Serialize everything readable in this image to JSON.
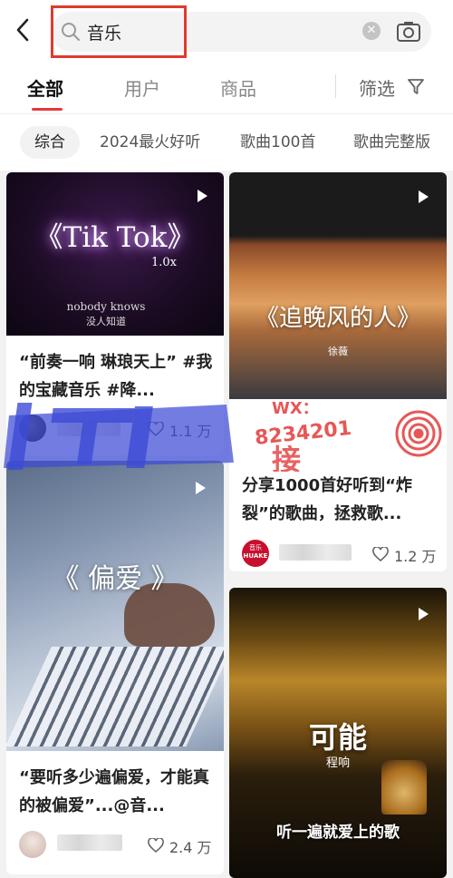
{
  "search": {
    "query": "音乐",
    "clear_glyph": "✕"
  },
  "tabs": [
    {
      "label": "全部"
    },
    {
      "label": "用户"
    },
    {
      "label": "商品"
    }
  ],
  "filter": {
    "label": "筛选"
  },
  "chips": [
    {
      "label": "综合"
    },
    {
      "label": "2024最火好听"
    },
    {
      "label": "歌曲100首"
    },
    {
      "label": "歌曲完整版"
    }
  ],
  "cards": [
    {
      "cover_title": "《Tik Tok》",
      "cover_speed": "1.0x",
      "cover_line1": "nobody knows",
      "cover_line2": "没人知道",
      "title": "“前奏一响 琳琅天上” #我的宝藏音乐 #降...",
      "likes": "1.1 万"
    },
    {
      "cover_title": "《追晚风的人》",
      "cover_artist": "徐薇",
      "title": "分享1000首好听到“炸裂”的歌曲，拯救歌...",
      "avatar_top": "音乐",
      "avatar_text": "HUAKE",
      "likes": "1.2 万"
    },
    {
      "cover_title": "《 偏爱 》",
      "title": "“要听多少遍偏爱，才能真的被偏爱”...@音...",
      "likes": "2.4 万"
    },
    {
      "cover_title": "可能",
      "cover_artist": "程响",
      "cover_sub": "听一遍就爱上的歌"
    }
  ],
  "watermark": {
    "wx": "WX：",
    "number": "8234201",
    "label": "接"
  },
  "colors": {
    "accent": "#e5383b",
    "annotation_red": "#e03a2f",
    "watermark_blue": "#3d4bd6"
  },
  "icons": [
    "back-arrow-icon",
    "search-icon",
    "clear-icon",
    "camera-icon",
    "filter-icon",
    "play-icon",
    "heart-icon"
  ]
}
